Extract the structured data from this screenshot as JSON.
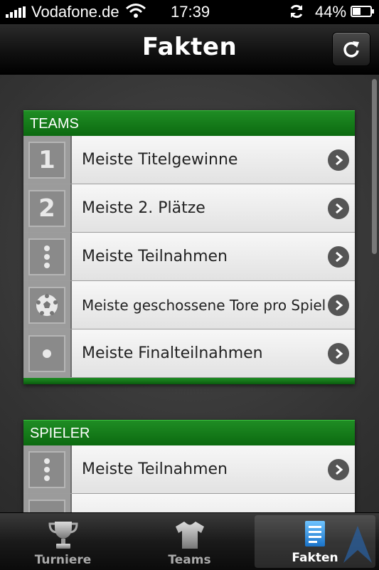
{
  "status_bar": {
    "carrier": "Vodafone.de",
    "time": "17:39",
    "battery": "44%"
  },
  "nav": {
    "title": "Fakten"
  },
  "sections": [
    {
      "header": "TEAMS",
      "rows": [
        {
          "icon": "number-1-icon",
          "glyph": "1",
          "label": "Meiste Titelgewinne"
        },
        {
          "icon": "number-2-icon",
          "glyph": "2",
          "label": "Meiste 2. Plätze"
        },
        {
          "icon": "dots-icon",
          "glyph": "",
          "label": "Meiste Teilnahmen"
        },
        {
          "icon": "soccer-ball-icon",
          "glyph": "",
          "label": "Meiste geschossene Tore pro Spiel"
        },
        {
          "icon": "dot-icon",
          "glyph": "",
          "label": "Meiste Finalteilnahmen"
        }
      ]
    },
    {
      "header": "SPIELER",
      "rows": [
        {
          "icon": "dots-icon",
          "glyph": "",
          "label": "Meiste Teilnahmen"
        }
      ]
    }
  ],
  "tabs": [
    {
      "label": "Turniere",
      "icon": "trophy-icon"
    },
    {
      "label": "Teams",
      "icon": "jersey-icon"
    },
    {
      "label": "Fakten",
      "icon": "document-icon",
      "active": true
    }
  ],
  "colors": {
    "section_green": "#138018",
    "tab_active_icon": "#2a8fe0"
  }
}
